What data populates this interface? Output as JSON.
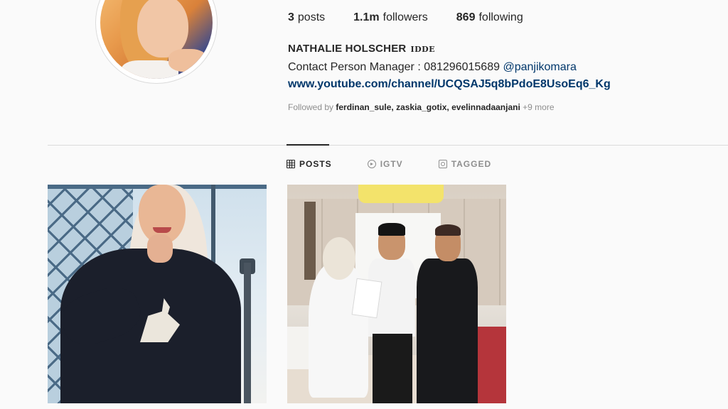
{
  "profile": {
    "stats": {
      "posts_count": "3",
      "posts_label": "posts",
      "followers_count": "1.1m",
      "followers_label": "followers",
      "following_count": "869",
      "following_label": "following"
    },
    "name": "NATHALIE HOLSCHER",
    "name_suffix": "IDDE",
    "bio_text": "Contact Person Manager : 081296015689",
    "bio_mention": "@panjikomara",
    "website": "www.youtube.com/channel/UCQSAJ5q8bPdoE8UsoEq6_Kg",
    "followed_by_prefix": "Followed by",
    "followed_by_users": "ferdinan_sule, zaskia_gotix, evelinnadaanjani",
    "followed_by_more": "+9 more"
  },
  "tabs": [
    {
      "label": "POSTS",
      "icon": "grid-icon",
      "active": true
    },
    {
      "label": "IGTV",
      "icon": "igtv-icon",
      "active": false
    },
    {
      "label": "TAGGED",
      "icon": "tagged-icon",
      "active": false
    }
  ],
  "posts": [
    {
      "description_name": "post-thumbnail-1"
    },
    {
      "description_name": "post-thumbnail-2"
    }
  ],
  "colors": {
    "background": "#fafafa",
    "text_primary": "#262626",
    "text_secondary": "#8e8e8e",
    "link": "#00376b",
    "divider": "#dbdbdb"
  }
}
